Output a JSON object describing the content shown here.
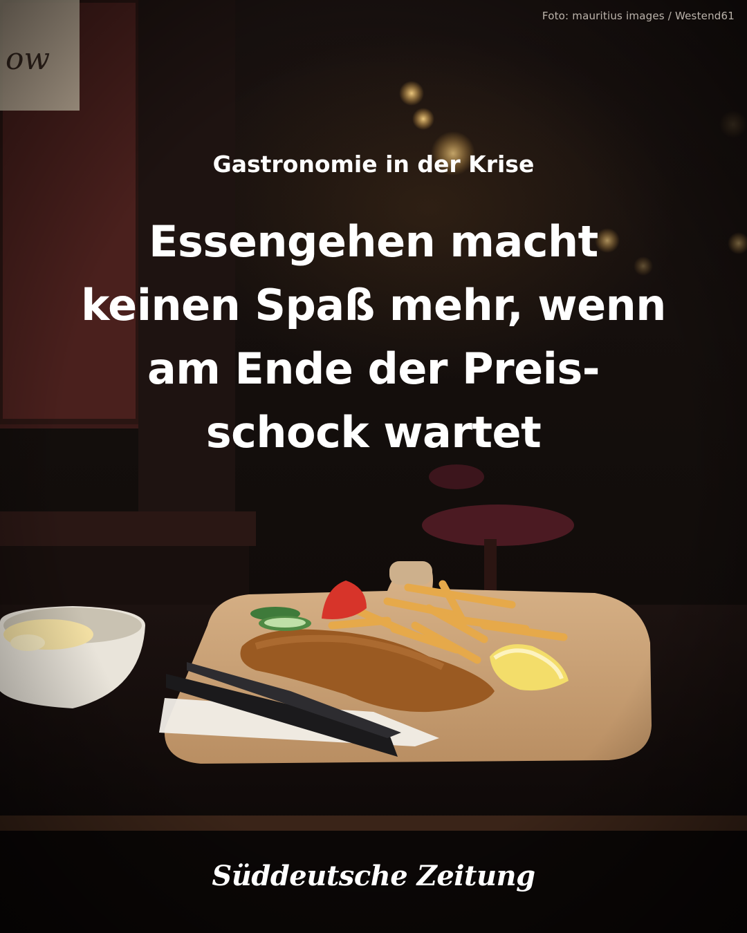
{
  "credit": "Foto: mauritius images / Westend61",
  "kicker": "Gastronomie in der Krise",
  "headline": {
    "lines": [
      "Essengehen macht",
      "keinen Spaß mehr, wenn",
      "am Ende der Preis-",
      "schock wartet"
    ]
  },
  "brand": "Süddeutsche Zeitung"
}
